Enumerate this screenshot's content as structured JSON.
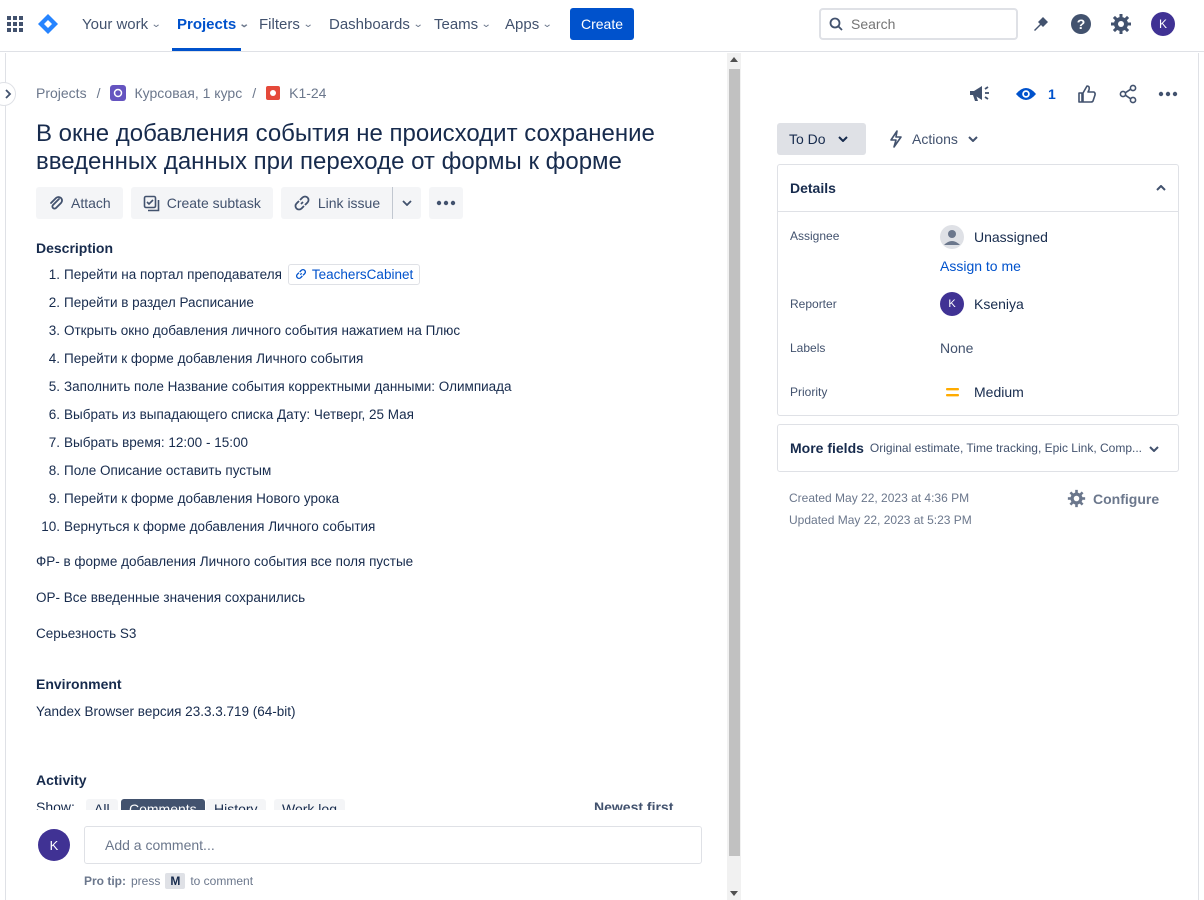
{
  "nav": {
    "items": [
      {
        "label": "Your work"
      },
      {
        "label": "Projects"
      },
      {
        "label": "Filters"
      },
      {
        "label": "Dashboards"
      },
      {
        "label": "Teams"
      },
      {
        "label": "Apps"
      }
    ],
    "create_label": "Create",
    "search_placeholder": "Search",
    "user_initial": "K"
  },
  "breadcrumb": {
    "root": "Projects",
    "project": "Курсовая, 1 курс",
    "issue_key": "K1-24"
  },
  "issue": {
    "title": "В окне добавления события не происходит сохранение введенных данных при переходе от формы к форме",
    "toolbar": {
      "attach": "Attach",
      "create_subtask": "Create subtask",
      "link_issue": "Link issue"
    },
    "description_label": "Description",
    "steps": [
      {
        "num": "1.",
        "text": "Перейти на портал преподавателя",
        "link": "TeachersCabinet"
      },
      {
        "num": "2.",
        "text": "Перейти в раздел Расписание"
      },
      {
        "num": "3.",
        "text": "Открыть окно добавления личного события нажатием на Плюс"
      },
      {
        "num": "4.",
        "text": "Перейти к форме добавления Личного события"
      },
      {
        "num": "5.",
        "text": "Заполнить поле Название события корректными данными: Олимпиада"
      },
      {
        "num": "6.",
        "text": "Выбрать из выпадающего списка Дату: Четверг, 25 Мая"
      },
      {
        "num": "7.",
        "text": "Выбрать время: 12:00 - 15:00"
      },
      {
        "num": "8.",
        "text": "Поле Описание оставить пустым"
      },
      {
        "num": "9.",
        "text": "Перейти к форме добавления Нового урока"
      },
      {
        "num": "10.",
        "text": "Вернуться к форме добавления Личного события"
      }
    ],
    "fr": "ФР- в форме добавления Личного события все поля пустые",
    "or": "ОР- Все введенные значения сохранились",
    "severity": "Серьезность S3",
    "environment_label": "Environment",
    "environment": "Yandex Browser версия 23.3.3.719 (64-bit)",
    "activity_label": "Activity",
    "activity": {
      "show_label": "Show:",
      "all": "All",
      "comments": "Comments",
      "history": "History",
      "worklog": "Work log",
      "sort": "Newest first"
    },
    "comment_placeholder": "Add a comment...",
    "protip_label": "Pro tip:",
    "protip_press": "press",
    "protip_key": "M",
    "protip_suffix": "to comment"
  },
  "side": {
    "watch_count": "1",
    "status": "To Do",
    "actions": "Actions",
    "details_title": "Details",
    "fields": {
      "assignee_label": "Assignee",
      "assignee_value": "Unassigned",
      "assign_to_me": "Assign to me",
      "reporter_label": "Reporter",
      "reporter_value": "Kseniya",
      "reporter_initial": "K",
      "labels_label": "Labels",
      "labels_value": "None",
      "priority_label": "Priority",
      "priority_value": "Medium"
    },
    "more_fields_label": "More fields",
    "more_fields_hint": "Original estimate, Time tracking, Epic Link, Comp...",
    "created": "Created May 22, 2023 at 4:36 PM",
    "updated": "Updated May 22, 2023 at 5:23 PM",
    "configure": "Configure"
  },
  "colors": {
    "brand": "#0052cc",
    "text": "#172b4d",
    "subtle": "#6b778c",
    "avatar": "#403294",
    "priority": "#ffab00"
  }
}
